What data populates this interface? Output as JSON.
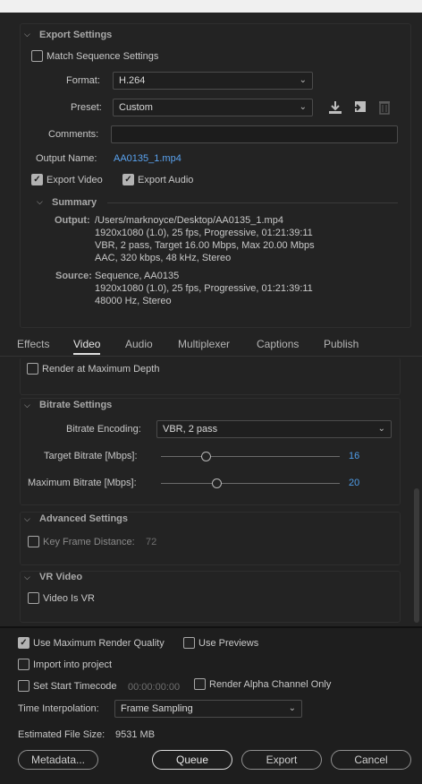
{
  "export_settings": {
    "header": "Export Settings",
    "match_sequence_label": "Match Sequence Settings",
    "format_label": "Format:",
    "format_value": "H.264",
    "preset_label": "Preset:",
    "preset_value": "Custom",
    "comments_label": "Comments:",
    "comments_value": "",
    "output_name_label": "Output Name:",
    "output_name_value": "AA0135_1.mp4",
    "export_video_label": "Export Video",
    "export_audio_label": "Export Audio",
    "summary_header": "Summary",
    "output_label": "Output:",
    "output_lines": [
      "/Users/marknoyce/Desktop/AA0135_1.mp4",
      "1920x1080 (1.0), 25 fps, Progressive, 01:21:39:11",
      "VBR, 2 pass, Target 16.00 Mbps, Max 20.00 Mbps",
      "AAC, 320 kbps, 48 kHz, Stereo"
    ],
    "source_label": "Source:",
    "source_lines": [
      "Sequence, AA0135",
      "1920x1080 (1.0), 25 fps, Progressive, 01:21:39:11",
      "48000 Hz, Stereo"
    ]
  },
  "tabs": [
    "Effects",
    "Video",
    "Audio",
    "Multiplexer",
    "Captions",
    "Publish"
  ],
  "video": {
    "render_max_depth_label": "Render at Maximum Depth",
    "bitrate_header": "Bitrate Settings",
    "bitrate_encoding_label": "Bitrate Encoding:",
    "bitrate_encoding_value": "VBR, 2 pass",
    "target_bitrate_label": "Target Bitrate [Mbps]:",
    "target_bitrate_value": "16",
    "max_bitrate_label": "Maximum Bitrate [Mbps]:",
    "max_bitrate_value": "20",
    "advanced_header": "Advanced Settings",
    "key_frame_label": "Key Frame Distance:",
    "key_frame_value": "72",
    "vr_header": "VR Video",
    "video_is_vr_label": "Video Is VR"
  },
  "bottom": {
    "use_max_render_label": "Use Maximum Render Quality",
    "use_previews_label": "Use Previews",
    "import_project_label": "Import into project",
    "set_start_timecode_label": "Set Start Timecode",
    "start_timecode_value": "00:00:00:00",
    "render_alpha_label": "Render Alpha Channel Only",
    "time_interp_label": "Time Interpolation:",
    "time_interp_value": "Frame Sampling",
    "est_file_size_label": "Estimated File Size:",
    "est_file_size_value": "9531 MB",
    "metadata_button": "Metadata...",
    "queue_button": "Queue",
    "export_button": "Export",
    "cancel_button": "Cancel"
  },
  "colors": {
    "accent_link": "#5aa3f0",
    "panel_bg": "#232323"
  }
}
